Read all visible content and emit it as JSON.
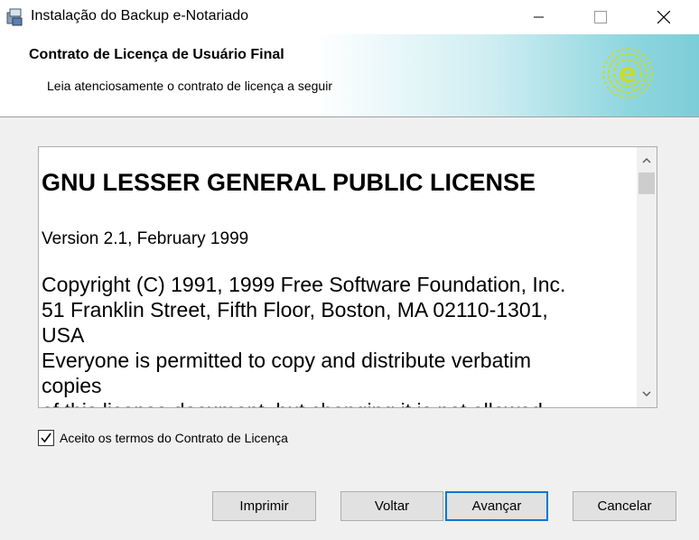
{
  "window": {
    "title": "Instalação do Backup e-Notariado",
    "icons": {
      "app": "installer-icon",
      "minimize": "minimize-icon",
      "maximize": "maximize-icon",
      "close": "close-icon"
    }
  },
  "header": {
    "title": "Contrato de Licença de Usuário Final",
    "subtitle": "Leia atenciosamente o contrato de licença a seguir",
    "logo_icon": "e-notariado-logo",
    "logo_color": "#c6dc2e"
  },
  "license": {
    "heading": "GNU LESSER GENERAL PUBLIC LICENSE",
    "version": "Version 2.1, February 1999",
    "body_lines": [
      "Copyright (C) 1991, 1999 Free Software Foundation, Inc.",
      "51 Franklin Street, Fifth Floor, Boston, MA  02110-1301,",
      "USA",
      "Everyone is permitted to copy and distribute verbatim",
      "copies",
      "of this license document, but changing it is not allowed."
    ],
    "scroll_up_icon": "scroll-up-icon",
    "scroll_down_icon": "scroll-down-icon"
  },
  "accept": {
    "label": "Aceito os termos do Contrato de Licença",
    "checked": true
  },
  "buttons": {
    "print": "Imprimir",
    "back": "Voltar",
    "next": "Avançar",
    "cancel": "Cancelar"
  }
}
